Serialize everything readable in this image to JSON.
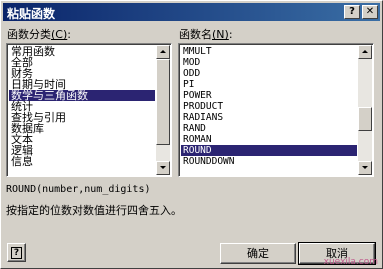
{
  "window": {
    "title": "粘贴函数",
    "help_glyph": "?",
    "close_glyph": "✕"
  },
  "category": {
    "label_text": "函数分类",
    "label_hotkey": "(C)",
    "label_suffix": ":",
    "items": [
      "常用函数",
      "全部",
      "财务",
      "日期与时间",
      "数学与三角函数",
      "统计",
      "查找与引用",
      "数据库",
      "文本",
      "逻辑",
      "信息"
    ],
    "selected_index": 4
  },
  "function_name": {
    "label_text": "函数名",
    "label_hotkey": "(N)",
    "label_suffix": ":",
    "items": [
      "MMULT",
      "MOD",
      "ODD",
      "PI",
      "POWER",
      "PRODUCT",
      "RADIANS",
      "RAND",
      "ROMAN",
      "ROUND",
      "ROUNDDOWN"
    ],
    "selected_index": 9
  },
  "syntax": "ROUND(number,num_digits)",
  "description": "按指定的位数对数值进行四舍五入。",
  "buttons": {
    "help": "?",
    "ok": "确定",
    "cancel": "取消"
  },
  "watermark": "xuexila.com"
}
